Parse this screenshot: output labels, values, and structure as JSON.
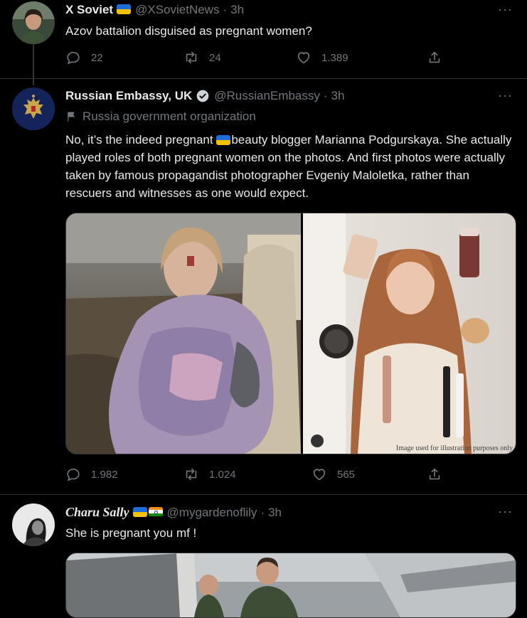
{
  "tweets": [
    {
      "name": "X Soviet",
      "handle": "@XSovietNews",
      "time": "3h",
      "text": "Azov battalion disguised as pregnant women?",
      "replies": "22",
      "retweets": "24",
      "likes": "1.389"
    },
    {
      "name": "Russian Embassy, UK",
      "handle": "@RussianEmbassy",
      "time": "3h",
      "gov_label": "Russia government organization",
      "text_before_flag": "No, it’s the indeed pregnant ",
      "text_after_flag": "beauty blogger Marianna Podgurskaya. She actually played roles of both pregnant women on the photos. And first photos were actually taken by famous propagandist photographer Evgeniy Maloletka, rather than rescuers and witnesses as one would expect.",
      "image_caption": "Image used for illustration purposes only",
      "replies": "1.982",
      "retweets": "1.024",
      "likes": "565"
    },
    {
      "name": "Charu Sally",
      "handle": "@mygardenoflily",
      "time": "3h",
      "text": "She is pregnant you mf !"
    }
  ],
  "dot_sep": "·",
  "more_glyph": "···",
  "colors": {
    "background": "#000000",
    "text": "#e7e9ea",
    "muted": "#71767b",
    "border": "#2f3336"
  }
}
